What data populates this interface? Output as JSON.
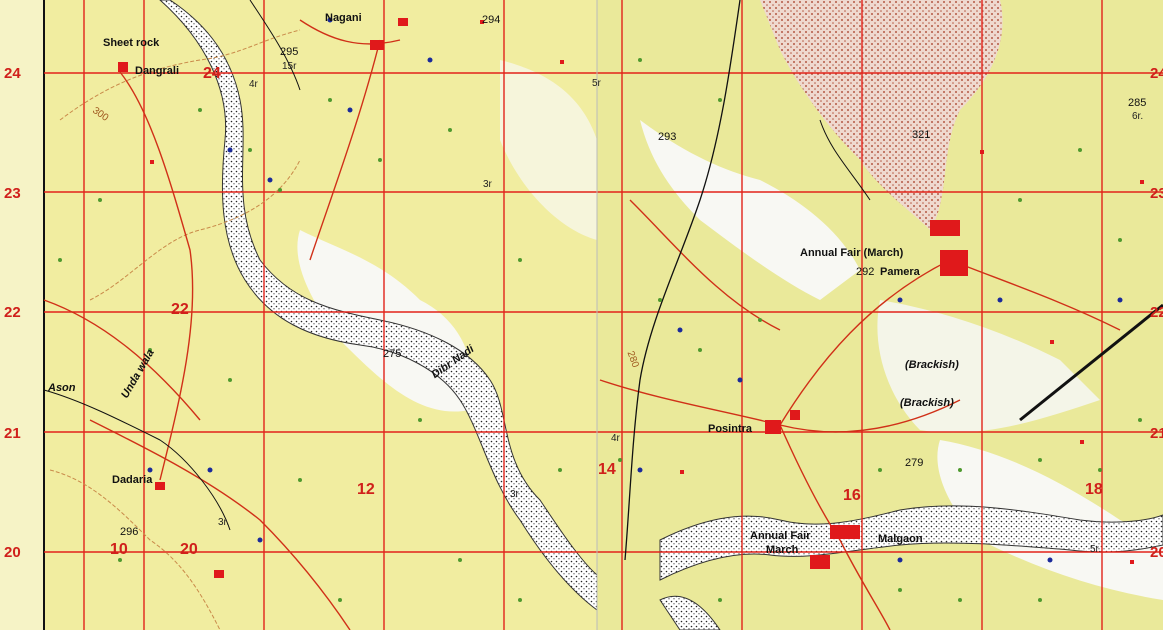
{
  "colors": {
    "land": "#f1eda0",
    "land_alt": "#eae99a",
    "white_area": "#f8f8f3",
    "grid": "#e2231a",
    "river_fill": "#ffffff",
    "river_dots": "#222222",
    "road": "#d03018",
    "track": "#e07a2a",
    "contour": "#c98a4a",
    "trees": "#4e9a2e",
    "blue_dots": "#1a2a9a",
    "red_dots": "#e0191b",
    "dune": "#d6a0a0"
  },
  "left_grid": {
    "northings": [
      "24",
      "23",
      "22",
      "21",
      "20"
    ],
    "cells": [
      "24",
      "22",
      "12",
      "10",
      "20"
    ]
  },
  "right_grid": {
    "northings": [
      "24",
      "23",
      "22",
      "21",
      "20"
    ],
    "cells": [
      "14",
      "16",
      "18"
    ]
  },
  "places": {
    "sheet_rock": "Sheet rock",
    "dangrali": "Dangrali",
    "nagani": "Nagani",
    "dadaria": "Dadaria",
    "unda_wala": "Unda wala",
    "ason": "Ason",
    "dibr_nadi": "Dibr Nadi",
    "pamera": "Pamera",
    "annual_fair_pamera": "Annual Fair (March)",
    "brackish_1": "(Brackish)",
    "brackish_2": "(Brackish)",
    "posintra": "Posintra",
    "malgaon": "Malgaon",
    "annual_fair_malgaon_1": "Annual Fair",
    "annual_fair_malgaon_2": "March"
  },
  "spot_heights": {
    "h295": "295",
    "h294": "294",
    "h275": "275",
    "h296": "296",
    "h293": "293",
    "h321": "321",
    "h292": "292",
    "h279": "279",
    "h285": "285",
    "h280": "280",
    "c300": "300"
  },
  "relative_relief": {
    "r15": "15r",
    "r4a": "4r",
    "r3a": "3r",
    "r3b": "3r.",
    "r5a": "5r",
    "r4b": "4r",
    "r3c": "3r",
    "r6": "6r.",
    "r5b": "5r."
  }
}
